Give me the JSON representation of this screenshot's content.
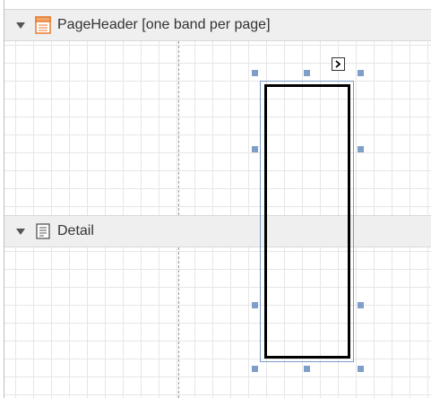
{
  "bands": {
    "page_header": {
      "label": "PageHeader [one band per page]",
      "icon": "page-header-band-icon",
      "expanded": true
    },
    "detail": {
      "label": "Detail",
      "icon": "detail-band-icon",
      "expanded": true
    }
  },
  "selected_control": {
    "type": "shape-rectangle",
    "smart_tag_icon": "smart-tag-arrow-icon"
  },
  "colors": {
    "band_header_bg": "#efefef",
    "grid_line": "#e6e6e6",
    "margin_line": "#9a9a9a",
    "selection_handle": "#7f9fc8",
    "page_header_icon_accent": "#e87b2e"
  }
}
